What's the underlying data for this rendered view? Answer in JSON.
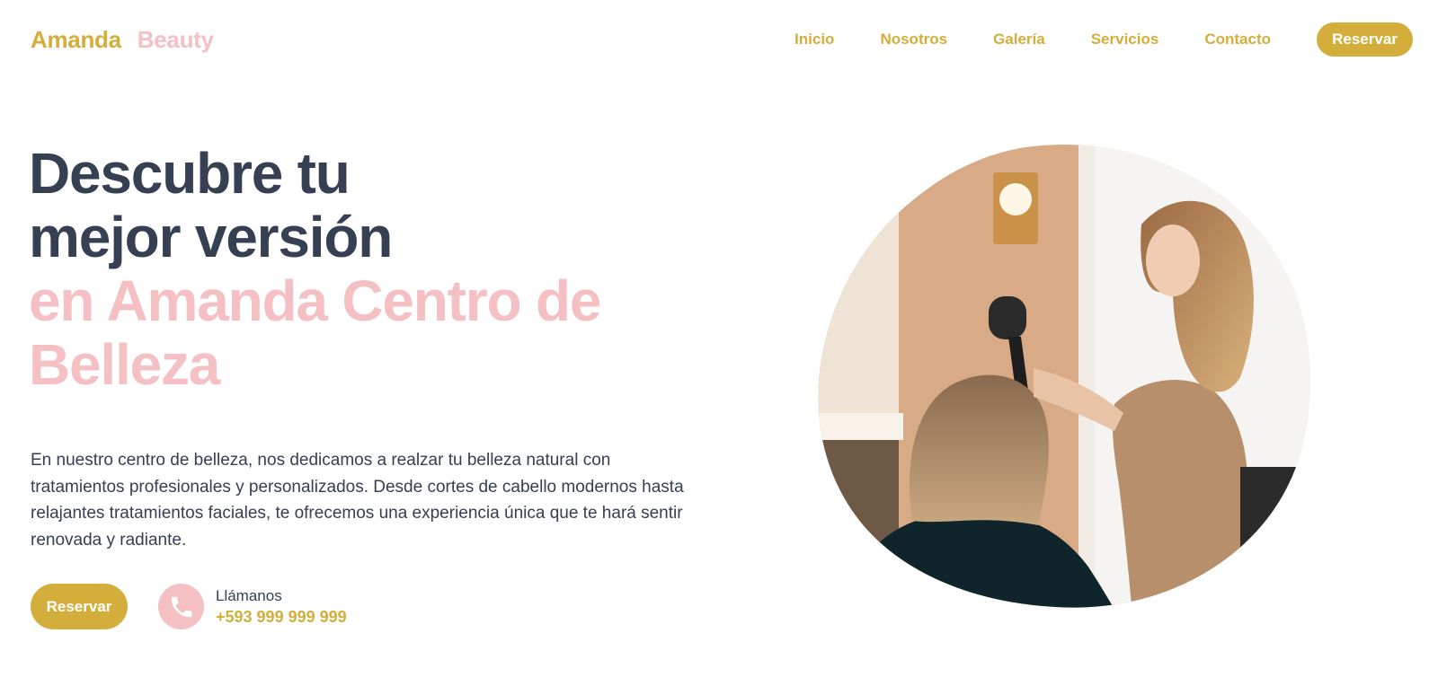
{
  "header": {
    "logo_part1": "Amanda",
    "logo_part2": "Beauty",
    "nav": [
      "Inicio",
      "Nosotros",
      "Galería",
      "Servicios",
      "Contacto"
    ],
    "cta": "Reservar"
  },
  "hero": {
    "title_line1": "Descubre tu",
    "title_line2": "mejor versión",
    "title_line3": "en Amanda Centro de",
    "title_line4": "Belleza",
    "description": "En nuestro centro de belleza, nos dedicamos a realzar tu belleza natural con tratamientos profesionales y personalizados. Desde cortes de cabello modernos hasta relajantes tratamientos faciales, te ofrecemos una experiencia única que te hará sentir renovada y radiante.",
    "cta": "Reservar",
    "phone_label": "Llámanos",
    "phone_number": "+593 999 999 999"
  },
  "colors": {
    "gold": "#d4ae3a",
    "pink": "#f4c0c3",
    "dark": "#364052"
  },
  "icons": {
    "phone": "phone-icon"
  }
}
